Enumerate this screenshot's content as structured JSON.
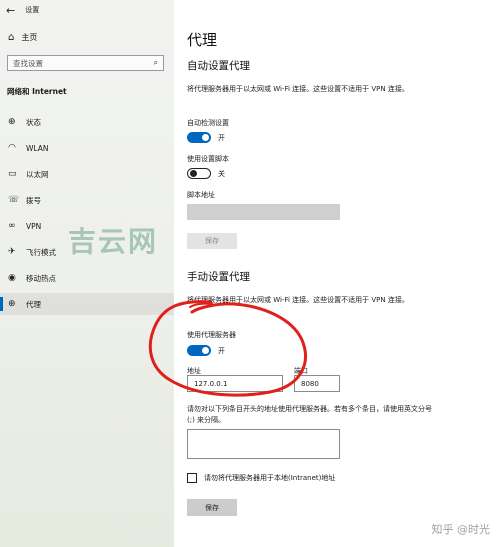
{
  "window": {
    "title": "设置",
    "back_glyph": "←"
  },
  "sidebar": {
    "home_label": "主页",
    "search_placeholder": "查找设置",
    "section_title": "网络和 Internet",
    "items": [
      {
        "label": "状态",
        "icon": "status-icon",
        "glyph": "⊕"
      },
      {
        "label": "WLAN",
        "icon": "wifi-icon",
        "glyph": "◠"
      },
      {
        "label": "以太网",
        "icon": "ethernet-icon",
        "glyph": "▭"
      },
      {
        "label": "拨号",
        "icon": "dialup-icon",
        "glyph": "☏"
      },
      {
        "label": "VPN",
        "icon": "vpn-icon",
        "glyph": "∞"
      },
      {
        "label": "飞行模式",
        "icon": "airplane-icon",
        "glyph": "✈"
      },
      {
        "label": "移动热点",
        "icon": "hotspot-icon",
        "glyph": "◉"
      },
      {
        "label": "代理",
        "icon": "globe-icon",
        "glyph": "⊕"
      }
    ],
    "active_index": 7
  },
  "watermark": "吉云网",
  "main": {
    "title": "代理",
    "auto": {
      "heading": "自动设置代理",
      "description": "将代理服务器用于以太网或 Wi-Fi 连接。这些设置不适用于 VPN 连接。",
      "detect_label": "自动检测设置",
      "detect_state": "开",
      "script_label": "使用设置脚本",
      "script_state": "关",
      "script_address_label": "脚本地址",
      "script_address_value": "",
      "save_label": "保存"
    },
    "manual": {
      "heading": "手动设置代理",
      "description": "将代理服务器用于以太网或 Wi-Fi 连接。这些设置不适用于 VPN 连接。",
      "use_proxy_label": "使用代理服务器",
      "use_proxy_state": "开",
      "address_label": "地址",
      "address_value": "127.0.0.1",
      "port_label": "端口",
      "port_value": "8080",
      "exceptions_description": "请勿对以下列条目开头的地址使用代理服务器。若有多个条目，请使用英文分号 (;) 来分隔。",
      "exceptions_value": "",
      "local_checkbox_label": "请勿将代理服务器用于本地(Intranet)地址",
      "local_checked": false,
      "save_label": "保存"
    }
  },
  "annotation": {
    "color": "#e0201b"
  },
  "credit": "知乎 @时光"
}
